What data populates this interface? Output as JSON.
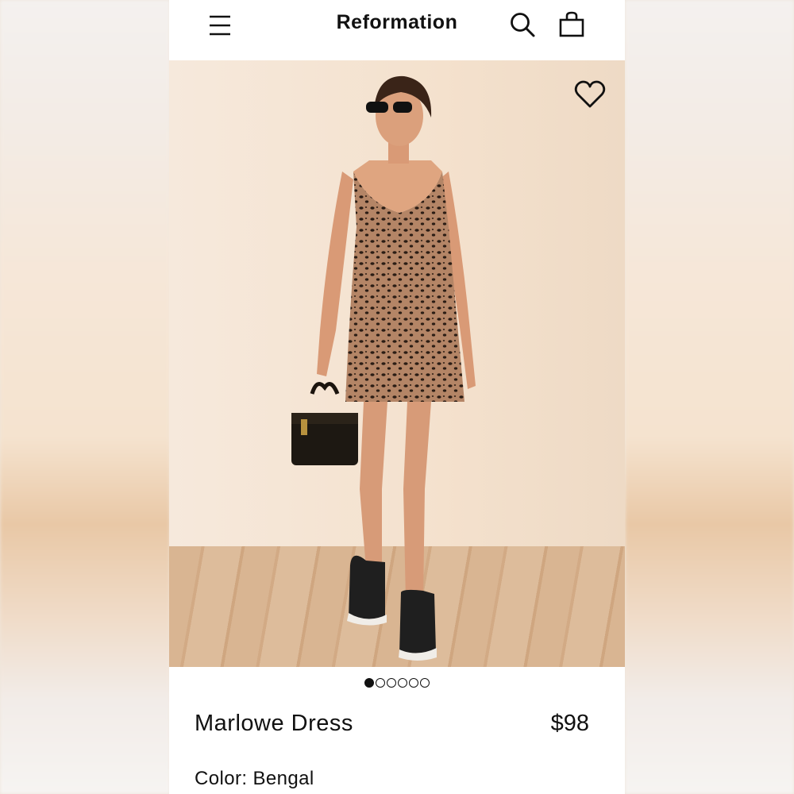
{
  "header": {
    "brand": "Reformation",
    "menu_icon": "hamburger-menu-icon",
    "search_icon": "search-icon",
    "bag_icon": "shopping-bag-icon"
  },
  "gallery": {
    "favorite_icon": "heart-icon",
    "image_count": 6,
    "active_index": 0
  },
  "product": {
    "name": "Marlowe Dress",
    "price": "$98",
    "color_label": "Color:",
    "color_value": "Bengal"
  },
  "colors": {
    "text": "#111111",
    "background": "#ffffff",
    "photo_backdrop": "#f4e1cd"
  }
}
